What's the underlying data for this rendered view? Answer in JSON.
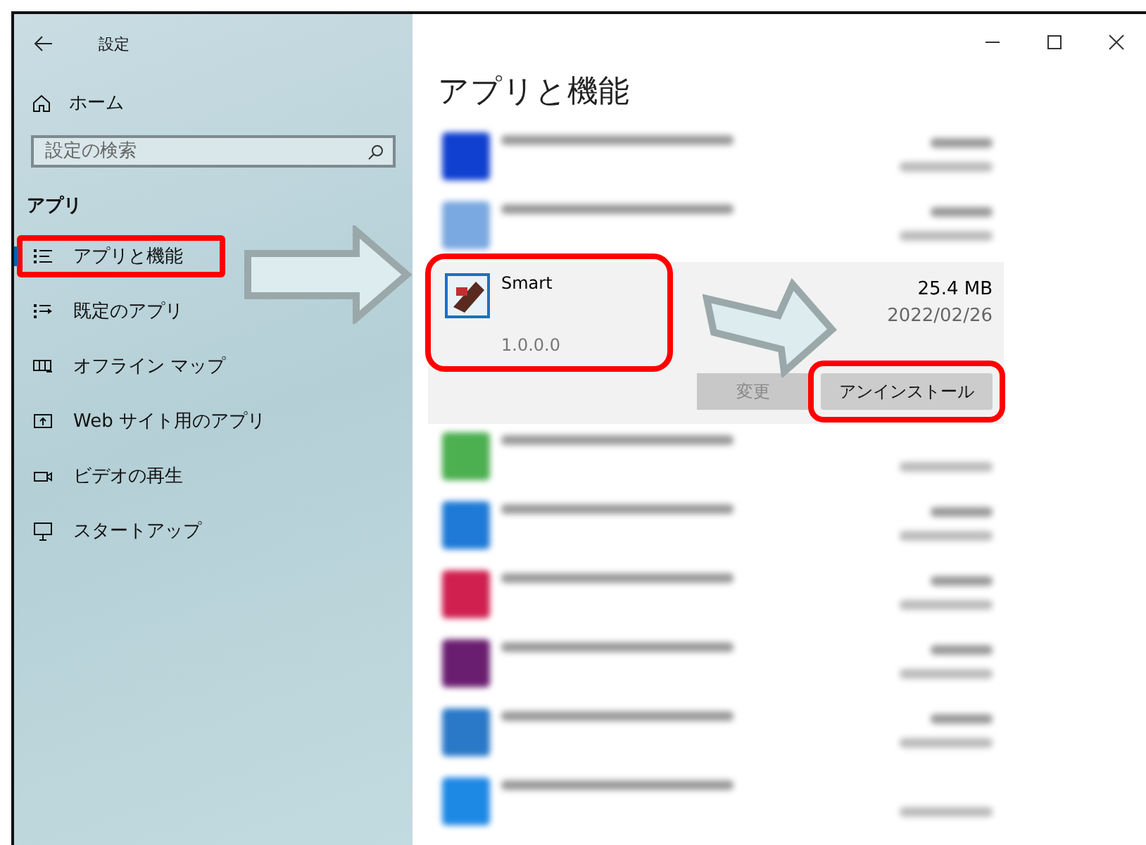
{
  "window": {
    "title": "設定"
  },
  "sidebar": {
    "home": "ホーム",
    "search": {
      "placeholder": "設定の検索"
    },
    "section": "アプリ",
    "items": [
      {
        "label": "アプリと機能",
        "selected": true,
        "annotated": true
      },
      {
        "label": "既定のアプリ",
        "selected": false,
        "annotated": false
      },
      {
        "label": "オフライン マップ",
        "selected": false,
        "annotated": false
      },
      {
        "label": "Web サイト用のアプリ",
        "selected": false,
        "annotated": false
      },
      {
        "label": "ビデオの再生",
        "selected": false,
        "annotated": false
      },
      {
        "label": "スタートアップ",
        "selected": false,
        "annotated": false
      }
    ]
  },
  "main": {
    "title": "アプリと機能",
    "apps": [
      {
        "kind": "blurred",
        "color": "#1040d0",
        "size_shown": true
      },
      {
        "kind": "blurred",
        "color": "#7aa8e0",
        "size_shown": true
      },
      {
        "kind": "expanded",
        "name": "Smart",
        "version": "1.0.0.0",
        "size": "25.4 MB",
        "date": "2022/02/26",
        "annotated": true,
        "buttons": [
          {
            "label": "変更",
            "disabled": true,
            "annotated": false
          },
          {
            "label": "アンインストール",
            "disabled": false,
            "annotated": true
          }
        ]
      },
      {
        "kind": "blurred",
        "color": "#4caf50",
        "size_shown": false
      },
      {
        "kind": "blurred",
        "color": "#1e7ad6",
        "size_shown": true
      },
      {
        "kind": "blurred",
        "color": "#d02050",
        "size_shown": true
      },
      {
        "kind": "blurred",
        "color": "#6a1e70",
        "size_shown": true
      },
      {
        "kind": "blurred",
        "color": "#2a78c8",
        "size_shown": true
      },
      {
        "kind": "blurred",
        "color": "#1e88e5",
        "size_shown": false
      }
    ]
  }
}
